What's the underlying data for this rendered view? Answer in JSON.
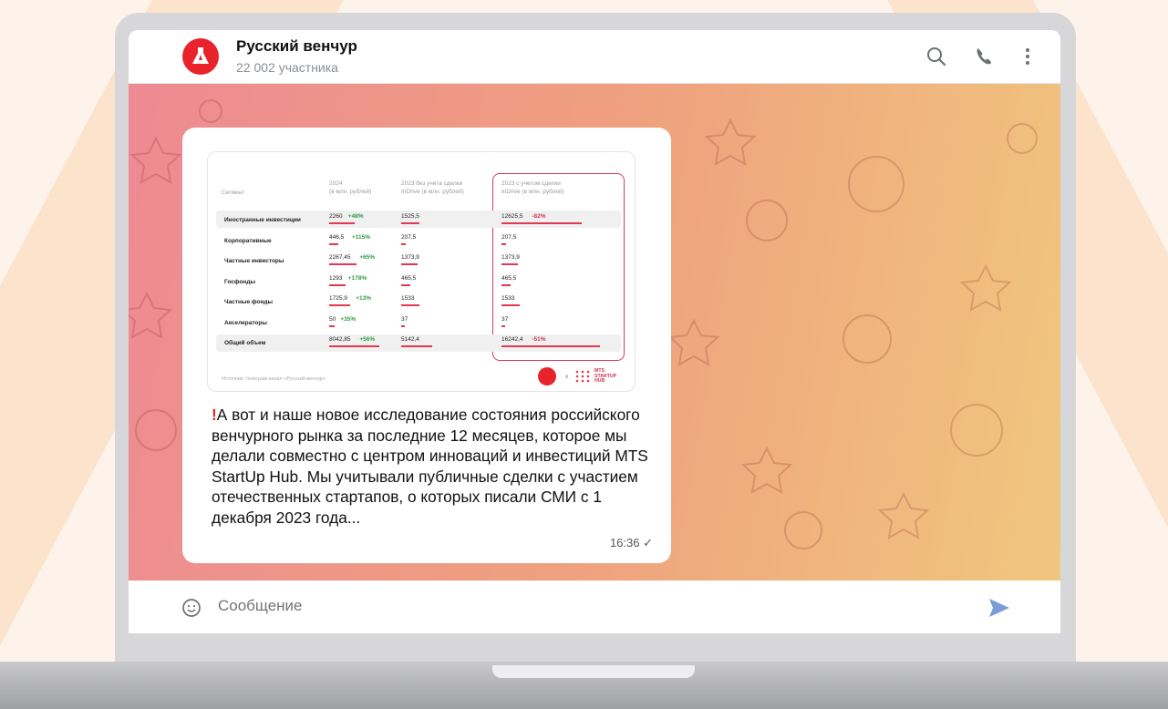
{
  "header": {
    "title": "Русский венчур",
    "subtitle": "22 002 участника"
  },
  "icons": {
    "avatar": "flask-rocket-logo",
    "search": "search-icon",
    "call": "phone-icon",
    "menu": "more-vertical-icon",
    "emoji": "emoji-icon",
    "send": "send-icon"
  },
  "colors": {
    "accent": "#e8232b",
    "positive": "#2e9a44",
    "negative": "#d23350",
    "send": "#7a9cd8"
  },
  "table": {
    "headers": {
      "segment": "Сегмент",
      "y2024": [
        "2024",
        "(в млн. рублей)"
      ],
      "y2023_without": [
        "2023 без учета сделки",
        "InDrive (в млн. рублей)"
      ],
      "y2023_with": [
        "2023 с учетом сделки",
        "InDrive (в млн. рублей)"
      ]
    },
    "rows": [
      {
        "segment": "Иностранные инвестиции",
        "v2024": "2260",
        "d2024": "+48%",
        "v2023a": "1525,5",
        "v2023b": "12625,5",
        "d2023b": "-82%"
      },
      {
        "segment": "Корпоративные",
        "v2024": "446,5",
        "d2024": "+115%",
        "v2023a": "207,5",
        "v2023b": "207,5",
        "d2023b": ""
      },
      {
        "segment": "Частные инвесторы",
        "v2024": "2267,45",
        "d2024": "+65%",
        "v2023a": "1373,9",
        "v2023b": "1373,9",
        "d2023b": ""
      },
      {
        "segment": "Госфонды",
        "v2024": "1293",
        "d2024": "+178%",
        "v2023a": "465,5",
        "v2023b": "465,5",
        "d2023b": ""
      },
      {
        "segment": "Частные фонды",
        "v2024": "1725,9",
        "d2024": "+13%",
        "v2023a": "1533",
        "v2023b": "1533",
        "d2023b": ""
      },
      {
        "segment": "Акселераторы",
        "v2024": "50",
        "d2024": "+35%",
        "v2023a": "37",
        "v2023b": "37",
        "d2023b": ""
      },
      {
        "segment": "Общий объем",
        "v2024": "8042,85",
        "d2024": "+56%",
        "v2023a": "5142,4",
        "v2023b": "16242,4",
        "d2023b": "-51%"
      }
    ],
    "source": "Источник: телеграм-канал «Русский венчур»",
    "partner_x": "x",
    "partner_logo": [
      "MTS",
      "STARTUP",
      "HUB"
    ]
  },
  "message": {
    "text": "А вот и наше новое исследование состояния российского венчурного рынка за последние 12 месяцев, которое мы делали совместно с центром инноваций и инвестиций MTS StartUp Hub. Мы учитывали публичные сделки с участием отечественных стартапов, о которых писали СМИ с 1 декабря 2023 года...",
    "time": "16:36 ✓"
  },
  "composer": {
    "placeholder": "Сообщение"
  }
}
